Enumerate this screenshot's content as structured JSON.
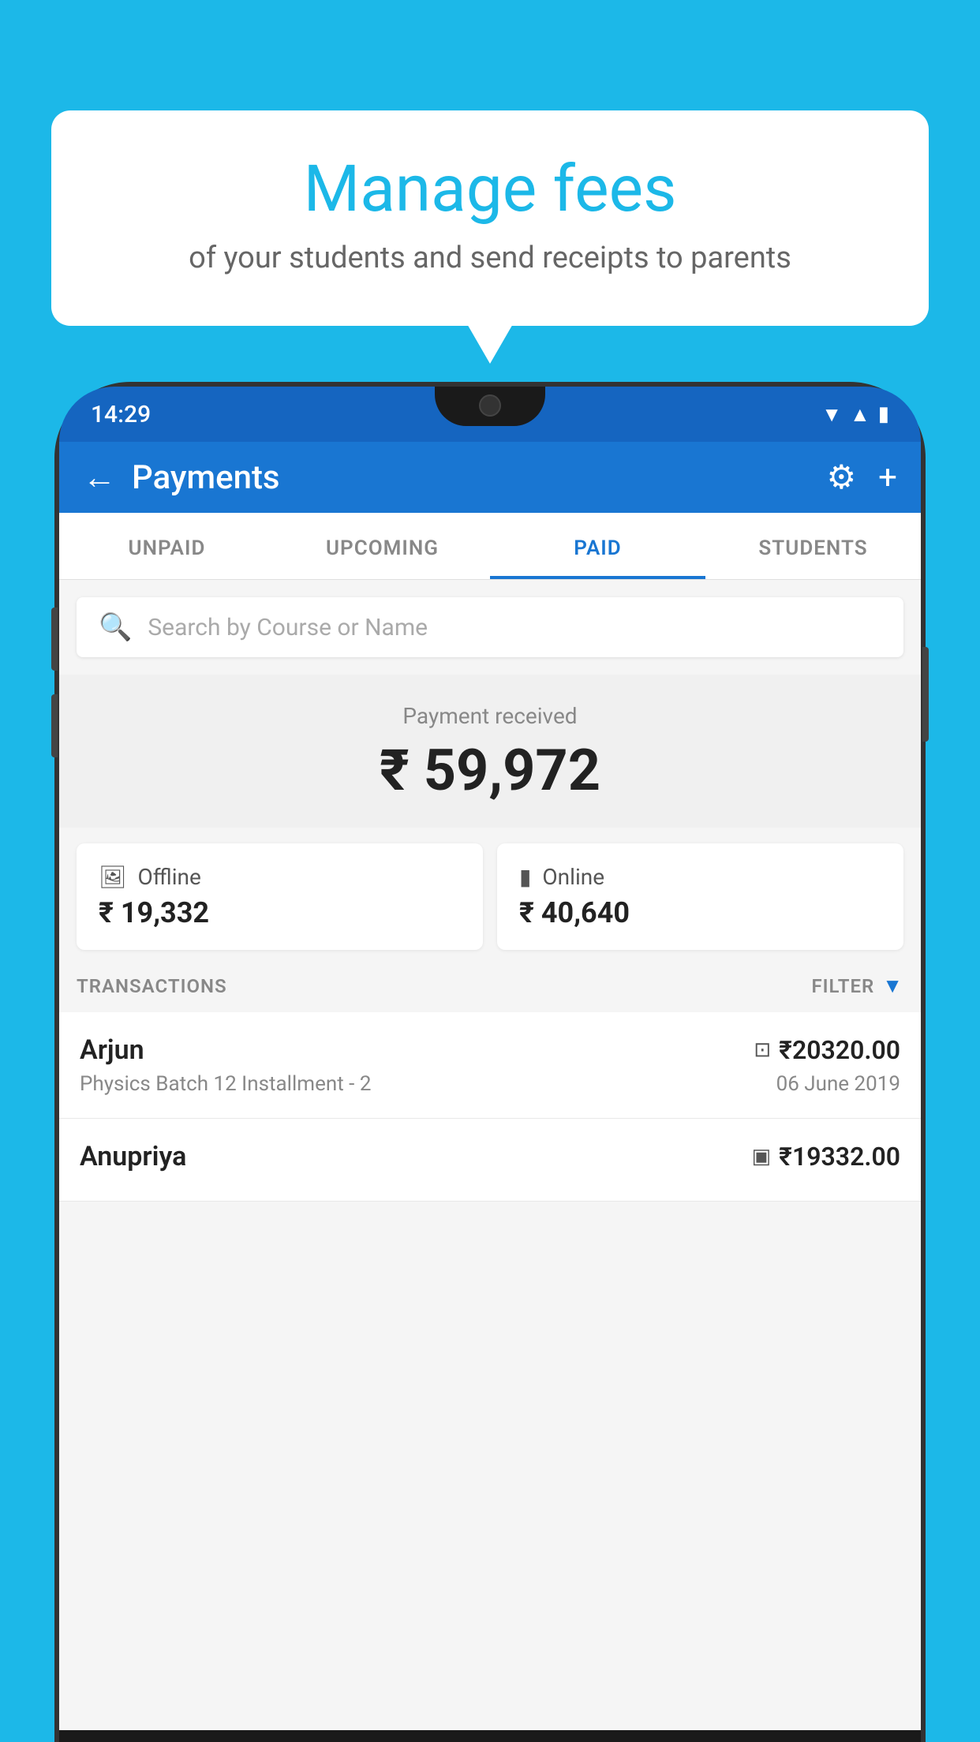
{
  "background_color": "#1cb8e8",
  "bubble": {
    "title": "Manage fees",
    "subtitle": "of your students and send receipts to parents"
  },
  "status_bar": {
    "time": "14:29",
    "wifi_icon": "▾",
    "signal_icon": "▲",
    "battery_icon": "▮"
  },
  "header": {
    "title": "Payments",
    "back_icon": "←",
    "gear_icon": "⚙",
    "plus_icon": "+"
  },
  "tabs": [
    {
      "id": "unpaid",
      "label": "UNPAID",
      "active": false
    },
    {
      "id": "upcoming",
      "label": "UPCOMING",
      "active": false
    },
    {
      "id": "paid",
      "label": "PAID",
      "active": true
    },
    {
      "id": "students",
      "label": "STUDENTS",
      "active": false
    }
  ],
  "search": {
    "placeholder": "Search by Course or Name"
  },
  "payment_received": {
    "label": "Payment received",
    "amount": "₹ 59,972"
  },
  "cards": [
    {
      "id": "offline",
      "icon": "▣",
      "title": "Offline",
      "amount": "₹ 19,332"
    },
    {
      "id": "online",
      "icon": "▬",
      "title": "Online",
      "amount": "₹ 40,640"
    }
  ],
  "transactions_section": {
    "label": "TRANSACTIONS",
    "filter_label": "FILTER",
    "filter_icon": "▼"
  },
  "transactions": [
    {
      "name": "Arjun",
      "description": "Physics Batch 12 Installment - 2",
      "amount": "₹20320.00",
      "date": "06 June 2019",
      "payment_icon": "▬",
      "payment_type": "online"
    },
    {
      "name": "Anupriya",
      "description": "",
      "amount": "₹19332.00",
      "date": "",
      "payment_icon": "▣",
      "payment_type": "offline"
    }
  ]
}
